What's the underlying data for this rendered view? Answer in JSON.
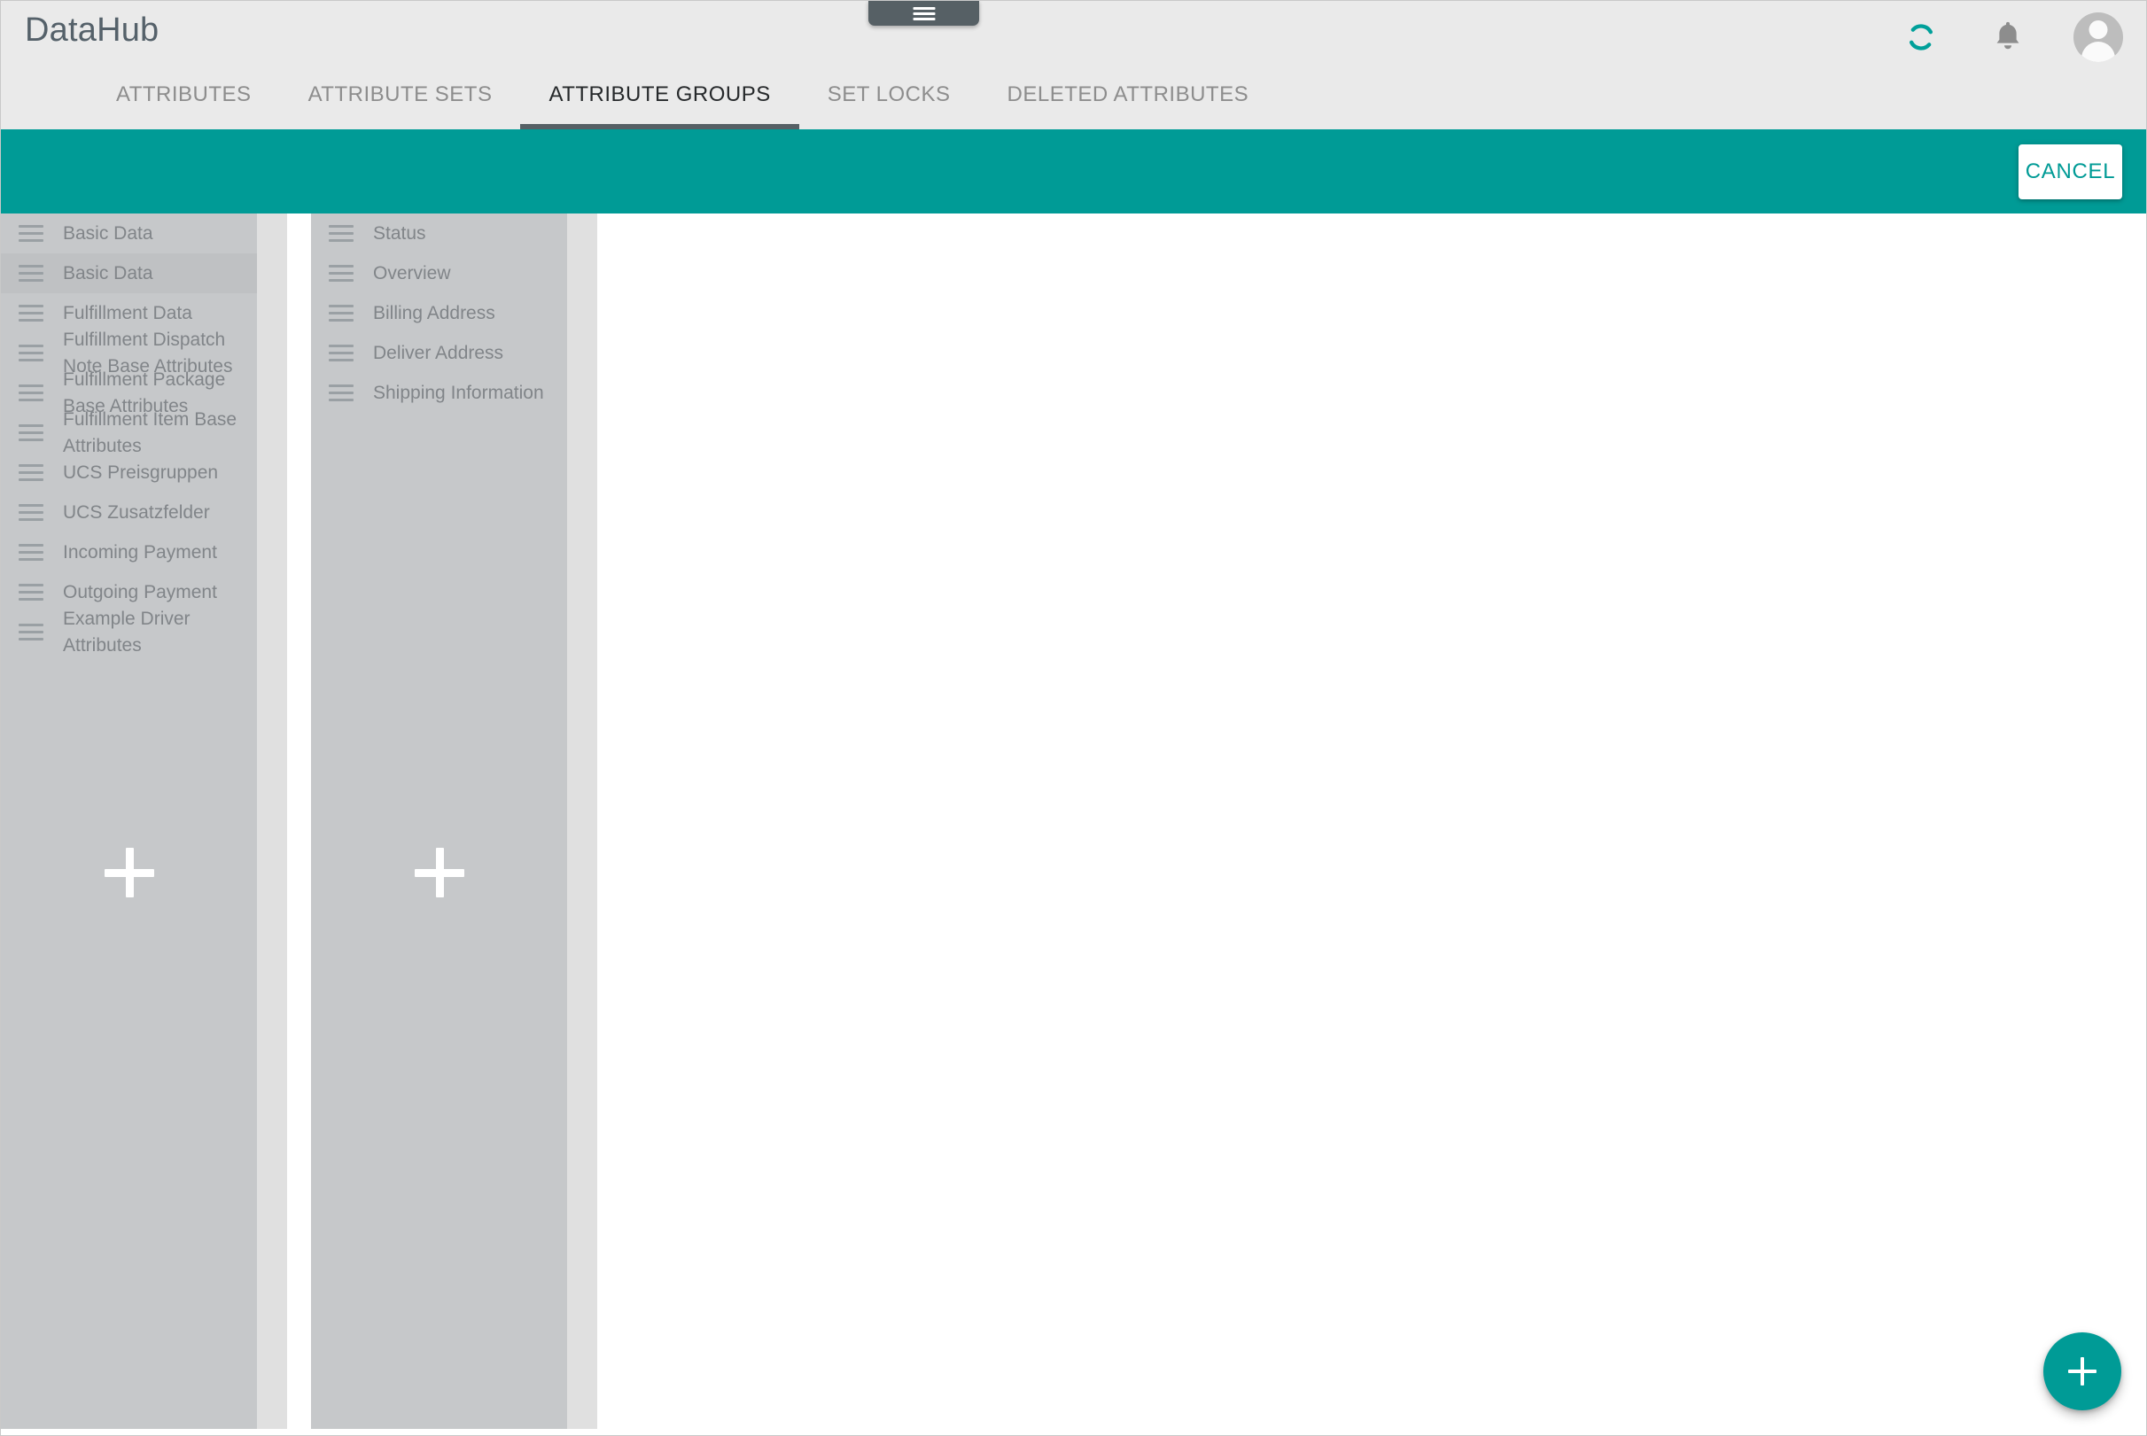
{
  "app": {
    "brand": "DataHub",
    "accent_color": "#009b96",
    "appbar_bg": "#eaeaea",
    "column_bg": "#c6c8ca",
    "active_tab_underline": "#566065"
  },
  "header": {
    "drawer_handle_icon": "hamburger-menu-icon",
    "actions": [
      {
        "icon": "sync-spinner-icon",
        "name": "sync-status-icon"
      },
      {
        "icon": "bell-icon",
        "name": "notifications-button"
      },
      {
        "icon": "avatar-icon",
        "name": "user-avatar-button"
      }
    ]
  },
  "tabs": [
    {
      "label": "ATTRIBUTES",
      "active": false
    },
    {
      "label": "ATTRIBUTE SETS",
      "active": false
    },
    {
      "label": "ATTRIBUTE GROUPS",
      "active": true
    },
    {
      "label": "SET LOCKS",
      "active": false
    },
    {
      "label": "DELETED ATTRIBUTES",
      "active": false
    }
  ],
  "action_bar": {
    "cancel_label": "CANCEL"
  },
  "columns": [
    {
      "name": "attribute-group-column-1",
      "add_label": "+",
      "items": [
        {
          "label": "Basic Data",
          "selected": false
        },
        {
          "label": "Basic Data",
          "selected": true
        },
        {
          "label": "Fulfillment Data",
          "selected": false
        },
        {
          "label": "Fulfillment Dispatch Note Base Attributes",
          "selected": false
        },
        {
          "label": "Fulfillment Package Base Attributes",
          "selected": false
        },
        {
          "label": "Fulfillment Item Base Attributes",
          "selected": false
        },
        {
          "label": "UCS Preisgruppen",
          "selected": false
        },
        {
          "label": "UCS Zusatzfelder",
          "selected": false
        },
        {
          "label": "Incoming Payment",
          "selected": false
        },
        {
          "label": "Outgoing Payment",
          "selected": false
        },
        {
          "label": "Example Driver Attributes",
          "selected": false
        }
      ]
    },
    {
      "name": "attribute-group-column-2",
      "add_label": "+",
      "items": [
        {
          "label": "Status",
          "selected": false
        },
        {
          "label": "Overview",
          "selected": false
        },
        {
          "label": "Billing Address",
          "selected": false
        },
        {
          "label": "Deliver Address",
          "selected": false
        },
        {
          "label": "Shipping Information",
          "selected": false
        }
      ]
    }
  ],
  "fab": {
    "icon": "plus-icon",
    "label": "+"
  }
}
